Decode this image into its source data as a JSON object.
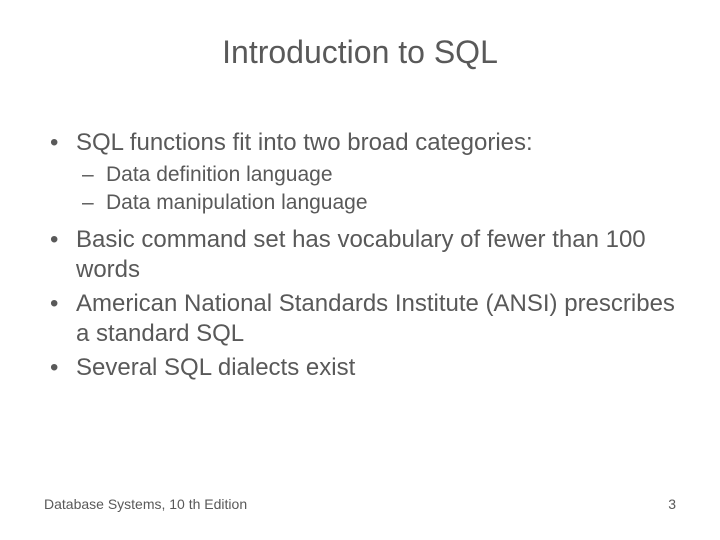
{
  "title": "Introduction to SQL",
  "bullets": {
    "b1": "SQL functions fit into two broad categories:",
    "b1a": "Data definition language",
    "b1b": "Data manipulation language",
    "b2": "Basic command set has vocabulary of fewer than 100 words",
    "b3": "American National Standards Institute (ANSI) prescribes a standard SQL",
    "b4": "Several SQL dialects exist"
  },
  "footer": {
    "source": "Database Systems, 10 th Edition",
    "page": "3"
  }
}
